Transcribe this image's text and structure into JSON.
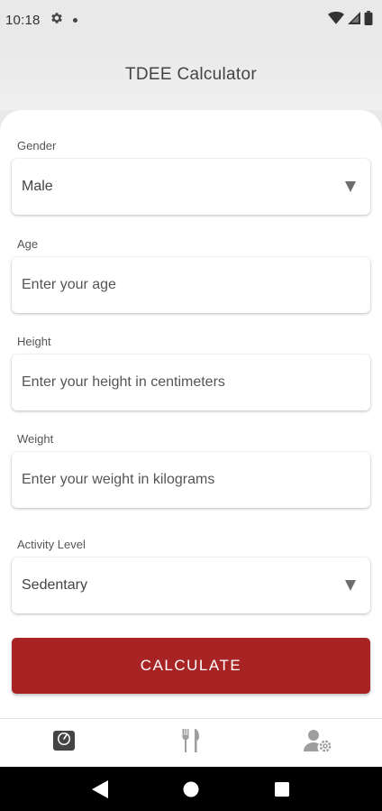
{
  "status_bar": {
    "time": "10:18",
    "icons": [
      "gear-icon",
      "notification-dot-icon",
      "wifi-icon",
      "signal-icon",
      "battery-icon"
    ]
  },
  "header": {
    "title": "TDEE Calculator"
  },
  "form": {
    "gender": {
      "label": "Gender",
      "value": "Male"
    },
    "age": {
      "label": "Age",
      "placeholder": "Enter your age"
    },
    "height": {
      "label": "Height",
      "placeholder": "Enter your height in centimeters"
    },
    "weight": {
      "label": "Weight",
      "placeholder": "Enter your weight in kilograms"
    },
    "activity": {
      "label": "Activity Level",
      "value": "Sedentary"
    },
    "calculate_label": "CALCULATE"
  },
  "bottom_nav": {
    "items": [
      {
        "icon": "scale-icon",
        "active": true
      },
      {
        "icon": "fork-knife-icon",
        "active": false
      },
      {
        "icon": "user-settings-icon",
        "active": false
      }
    ]
  },
  "colors": {
    "accent": "#a82424",
    "active_icon": "#444444",
    "inactive_icon": "#9e9e9e"
  }
}
